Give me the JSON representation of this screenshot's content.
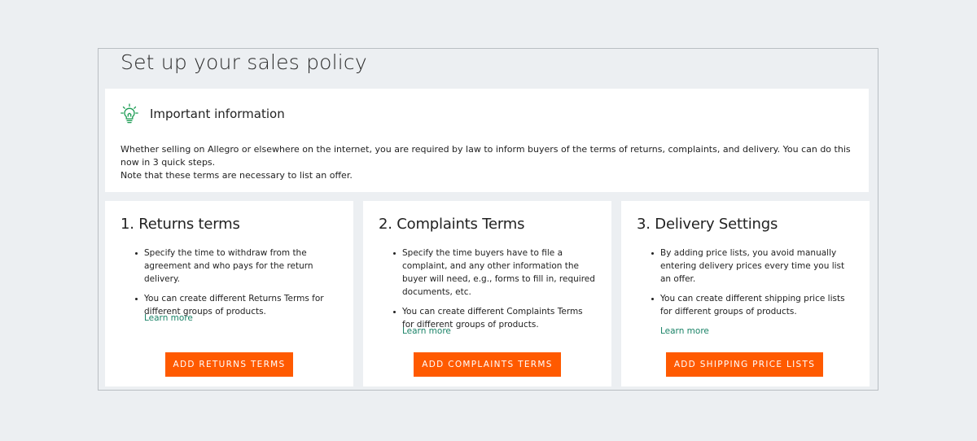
{
  "page": {
    "title": "Set up your sales policy"
  },
  "info": {
    "icon": "lightbulb-icon",
    "title": "Important information",
    "text_line1": "Whether selling on Allegro or elsewhere on the internet, you are required by law to inform buyers of the terms of returns, complaints, and delivery. You can do this now in 3 quick steps.",
    "text_line2": "Note that these terms are necessary to list an offer."
  },
  "cards": [
    {
      "title": "1. Returns terms",
      "bullets": [
        "Specify the time to withdraw from the agreement and who pays for the return delivery.",
        "You can create different Returns Terms for different groups of products."
      ],
      "link": "Learn more",
      "button": "ADD RETURNS TERMS"
    },
    {
      "title": "2. Complaints Terms",
      "bullets": [
        "Specify the time buyers have to file a complaint, and any other information the buyer will need, e.g., forms to fill in, required documents, etc.",
        "You can create different Complaints Terms for different groups of products."
      ],
      "link": "Learn more",
      "button": "ADD COMPLAINTS TERMS"
    },
    {
      "title": "3. Delivery Settings",
      "bullets": [
        "By adding price lists, you avoid manually entering delivery prices every time you list an offer.",
        "You can create different shipping price lists for different groups of products."
      ],
      "link": "Learn more",
      "button": "ADD SHIPPING PRICE LISTS"
    }
  ],
  "colors": {
    "accent": "#ff5a00",
    "link": "#1a8367",
    "icon": "#1a9b52",
    "background": "#eceff2"
  }
}
